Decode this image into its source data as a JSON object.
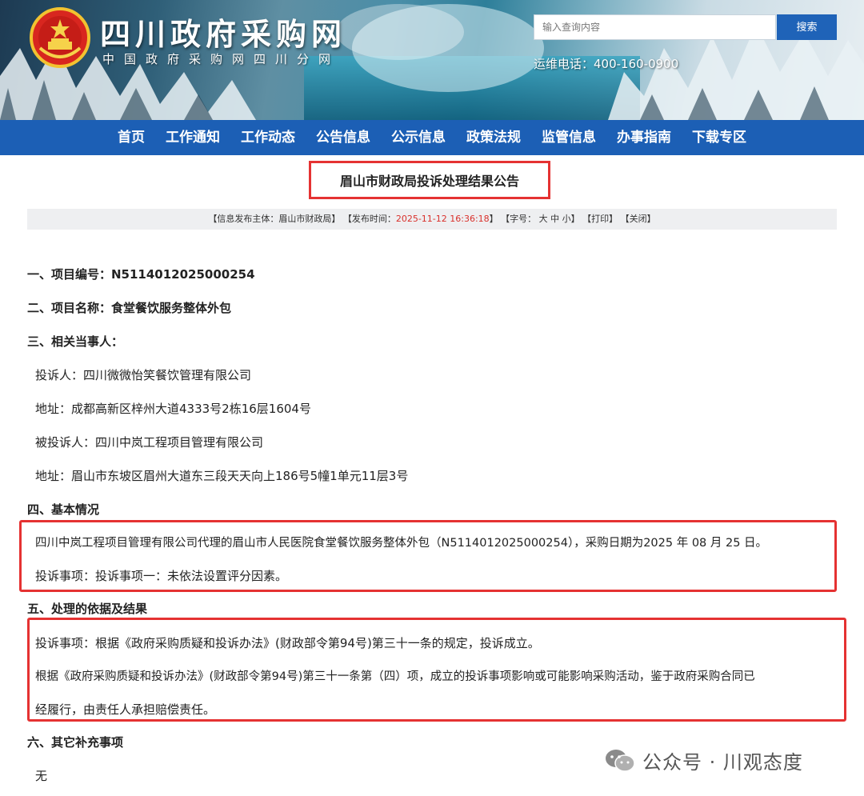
{
  "header": {
    "site_title": "四川政府采购网",
    "site_subtitle": "中国政府采购网四川分网",
    "search_placeholder": "输入查询内容",
    "search_button": "搜索",
    "hotline": "运维电话：400-160-0900"
  },
  "nav": {
    "items": [
      {
        "label": "首页"
      },
      {
        "label": "工作通知"
      },
      {
        "label": "工作动态"
      },
      {
        "label": "公告信息"
      },
      {
        "label": "公示信息"
      },
      {
        "label": "政策法规"
      },
      {
        "label": "监管信息"
      },
      {
        "label": "办事指南"
      },
      {
        "label": "下载专区"
      }
    ]
  },
  "article": {
    "title": "眉山市财政局投诉处理结果公告",
    "meta": {
      "publisher_label": "【信息发布主体：",
      "publisher": "眉山市财政局",
      "publisher_end": "】",
      "time_label": "【发布时间：",
      "time": "2025-11-12 16:36:18",
      "time_end": "】",
      "font_label": "【字号：",
      "font_large": "大",
      "font_medium": "中",
      "font_small": "小",
      "font_end": "】",
      "print": "【打印】",
      "close": "【关闭】"
    },
    "lines": {
      "h1": "一、项目编号：N5114012025000254",
      "h2": "二、项目名称：食堂餐饮服务整体外包",
      "h3": "三、相关当事人：",
      "complainant": "投诉人：四川微微怡笑餐饮管理有限公司",
      "complainant_addr": "地址：成都高新区梓州大道4333号2栋16层1604号",
      "respondent": "被投诉人：四川中岚工程项目管理有限公司",
      "respondent_addr": "地址：眉山市东坡区眉州大道东三段天天向上186号5幢1单元11层3号",
      "h4": "四、基本情况",
      "basic_1": "四川中岚工程项目管理有限公司代理的眉山市人民医院食堂餐饮服务整体外包（N5114012025000254），采购日期为2025 年 08 月 25 日。",
      "basic_2": "投诉事项：投诉事项一：未依法设置评分因素。",
      "h5": "五、处理的依据及结果",
      "result_1": "投诉事项：根据《政府采购质疑和投诉办法》(财政部令第94号)第三十一条的规定，投诉成立。",
      "result_2a": "根据《政府采购质疑和投诉办法》(财政部令第94号)第三十一条第（四）项，成立的投诉事项影响或可能影响采购活动，鉴于政府采购合同已",
      "result_2b": "经履行，由责任人承担赔偿责任。",
      "h6": "六、其它补充事项",
      "other": "无"
    }
  },
  "watermark": {
    "text": "公众号 · 川观态度",
    "icon": "wechat-icon"
  },
  "colors": {
    "nav_bg": "#1c5fb5",
    "highlight_border": "#e53232",
    "meta_time": "#d9302b"
  }
}
